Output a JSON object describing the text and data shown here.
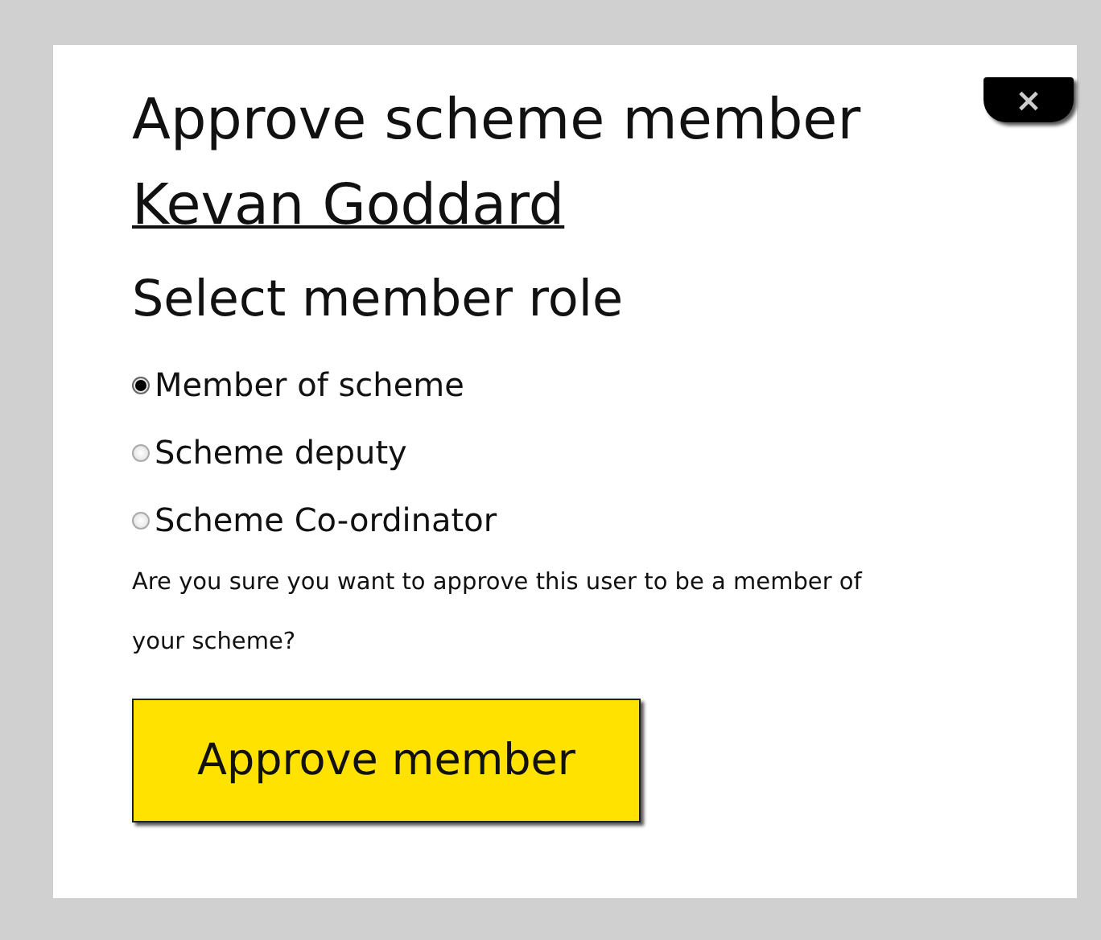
{
  "dialog": {
    "title": "Approve scheme member",
    "member_name": "Kevan Goddard",
    "close_label": "×"
  },
  "role_heading": "Select member role",
  "roles": [
    {
      "label": "Member of scheme",
      "selected": true
    },
    {
      "label": "Scheme deputy",
      "selected": false
    },
    {
      "label": "Scheme Co-ordinator",
      "selected": false
    }
  ],
  "confirmation": "Are you sure you want to approve this user to be a member of your scheme?",
  "approve_button": "Approve member"
}
